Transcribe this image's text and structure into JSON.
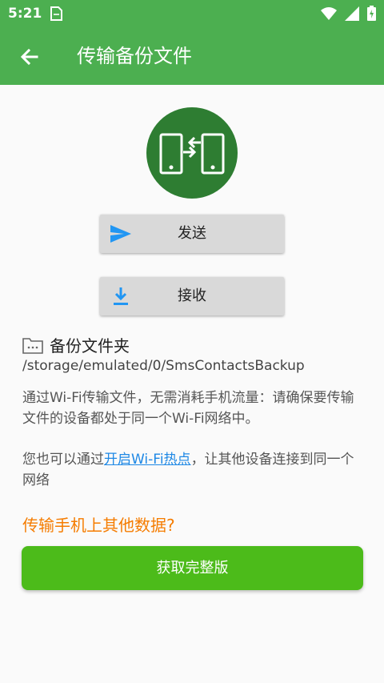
{
  "status_bar": {
    "time": "5:21",
    "icons": [
      "sd-card-icon",
      "wifi-icon",
      "signal-icon",
      "battery-charging-icon"
    ]
  },
  "app_bar": {
    "title": "传输备份文件",
    "back_icon": "arrow-left-icon"
  },
  "logo": {
    "icon": "phone-transfer-icon",
    "color": "#2e7d32"
  },
  "actions": {
    "send_label": "发送",
    "receive_label": "接收"
  },
  "folder": {
    "title": "备份文件夹",
    "path": "/storage/emulated/0/SmsContactsBackup"
  },
  "info": {
    "wifi_notice": "通过Wi-Fi传输文件，无需消耗手机流量：请确保要传输文件的设备都处于同一个Wi-Fi网络中。",
    "hotspot_prefix": "您也可以通过",
    "hotspot_link": "开启Wi-Fi热点",
    "hotspot_suffix": "，让其他设备连接到同一个网络"
  },
  "promo": {
    "text": "传输手机上其他数据?",
    "button_label": "获取完整版"
  },
  "colors": {
    "primary": "#4caf50",
    "logo_bg": "#2e7d32",
    "link": "#1e88e5",
    "promo": "#f57c00",
    "cta": "#4cbb1a"
  }
}
